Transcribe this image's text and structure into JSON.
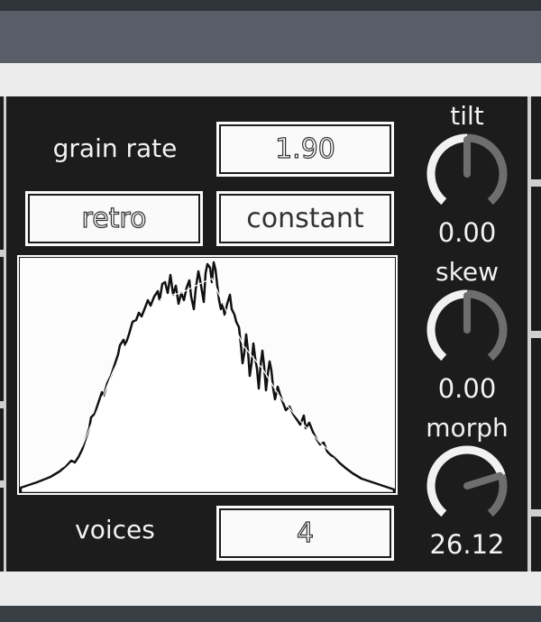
{
  "grain_rate": {
    "label": "grain rate",
    "value": "1.90"
  },
  "mode_buttons": [
    {
      "label": "retro"
    },
    {
      "label": "constant"
    }
  ],
  "voices": {
    "label": "voices",
    "value": "4"
  },
  "knobs": {
    "tilt": {
      "title": "tilt",
      "value": "0.00",
      "fraction": 0.5
    },
    "skew": {
      "title": "skew",
      "value": "0.00",
      "fraction": 0.5
    },
    "morph": {
      "title": "morph",
      "value": "26.12",
      "fraction": 0.76
    }
  },
  "colors": {
    "panel": "#1c1c1c",
    "text": "#f2f2f2",
    "knob_track": "#6e6e6e",
    "knob_active": "#f2f2f2"
  }
}
